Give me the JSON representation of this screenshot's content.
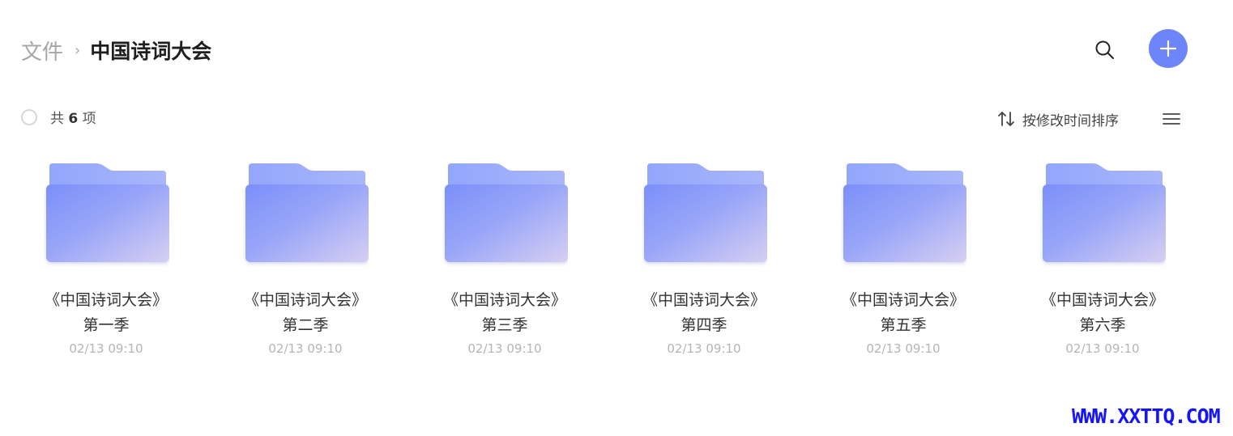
{
  "breadcrumb": {
    "root": "文件",
    "separator": "›",
    "current": "中国诗词大会"
  },
  "toolbar": {
    "count_prefix": "共",
    "count_value": "6",
    "count_suffix": "项",
    "sort_label": "按修改时间排序"
  },
  "icons": {
    "search": "search-icon",
    "add": "plus-icon",
    "sort": "sort-arrows-icon",
    "view": "list-view-icon",
    "folder": "folder-icon"
  },
  "colors": {
    "accent": "#6d85f8",
    "folder_back": "#9aacfb",
    "folder_front_start": "#7f93f9",
    "folder_front_end": "#d3cdf3"
  },
  "folders": [
    {
      "name_line1": "《中国诗词大会》",
      "name_line2": "第一季",
      "time": "02/13 09:10"
    },
    {
      "name_line1": "《中国诗词大会》",
      "name_line2": "第二季",
      "time": "02/13 09:10"
    },
    {
      "name_line1": "《中国诗词大会》",
      "name_line2": "第三季",
      "time": "02/13 09:10"
    },
    {
      "name_line1": "《中国诗词大会》",
      "name_line2": "第四季",
      "time": "02/13 09:10"
    },
    {
      "name_line1": "《中国诗词大会》",
      "name_line2": "第五季",
      "time": "02/13 09:10"
    },
    {
      "name_line1": "《中国诗词大会》",
      "name_line2": "第六季",
      "time": "02/13 09:10"
    }
  ],
  "watermark": "WWW.XXTTQ.COM"
}
